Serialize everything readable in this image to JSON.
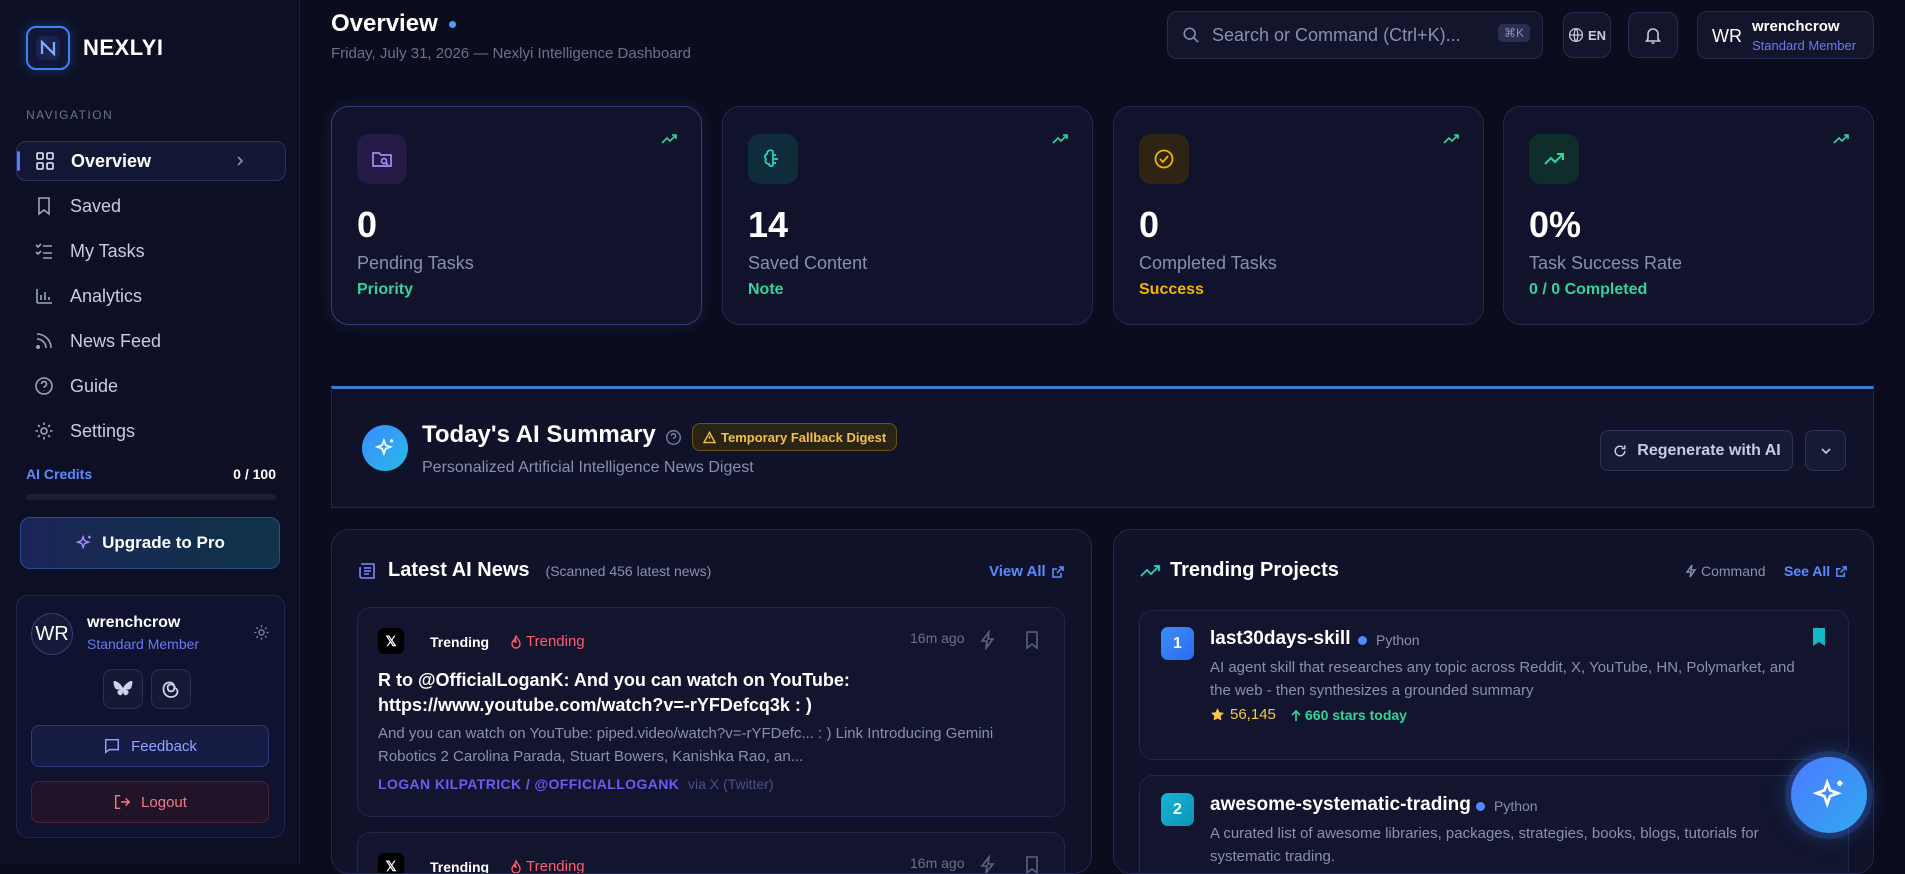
{
  "app": {
    "name": "NEXLYI"
  },
  "nav": {
    "label": "NAVIGATION",
    "items": [
      {
        "label": "Overview",
        "icon": "grid-icon",
        "active": true
      },
      {
        "label": "Saved",
        "icon": "bookmark-icon"
      },
      {
        "label": "My Tasks",
        "icon": "tasks-icon"
      },
      {
        "label": "Analytics",
        "icon": "bar-chart-icon"
      },
      {
        "label": "News Feed",
        "icon": "rss-icon"
      },
      {
        "label": "Guide",
        "icon": "help-circle-icon"
      },
      {
        "label": "Settings",
        "icon": "gear-icon"
      }
    ]
  },
  "credits": {
    "label": "AI Credits",
    "value": "0 / 100",
    "used_fraction": 0
  },
  "upgrade": {
    "label": "Upgrade to Pro"
  },
  "user": {
    "initials": "WR",
    "name": "wrenchcrow",
    "role": "Standard Member"
  },
  "sidebar_card": {
    "feedback": "Feedback",
    "logout": "Logout"
  },
  "header": {
    "title": "Overview",
    "subtitle": "Friday, July 31, 2026 — Nexlyi Intelligence Dashboard",
    "search_placeholder": "Search or Command (Ctrl+K)...",
    "search_kbd": "⌘K",
    "language": "EN"
  },
  "stats": [
    {
      "value": "0",
      "label": "Pending Tasks",
      "tag": "Priority",
      "color": "#34d399"
    },
    {
      "value": "14",
      "label": "Saved Content",
      "tag": "Note",
      "color": "#34d399"
    },
    {
      "value": "0",
      "label": "Completed Tasks",
      "tag": "Success",
      "color": "#f5b400"
    },
    {
      "value": "0%",
      "label": "Task Success Rate",
      "tag": "0 / 0 Completed",
      "color": "#34d399"
    }
  ],
  "summary": {
    "title": "Today's AI Summary",
    "badge": "Temporary Fallback Digest",
    "subtitle": "Personalized Artificial Intelligence News Digest",
    "regenerate": "Regenerate with AI"
  },
  "news": {
    "title": "Latest AI News",
    "scanned": "(Scanned 456 latest news)",
    "view_all": "View All",
    "items": [
      {
        "source": "Trending",
        "trend": "Trending",
        "time": "16m ago",
        "title": "R to @OfficialLoganK: And you can watch on YouTube: https://www.youtube.com/watch?v=-rYFDefcq3k : )",
        "desc": "And you can watch on YouTube: piped.video/watch?v=-rYFDefc... : ) Link Introducing Gemini Robotics 2 Carolina Parada, Stuart Bowers, Kanishka Rao, an...",
        "author": "LOGAN KILPATRICK / @OFFICIALLOGANK",
        "via": "via X (Twitter)"
      },
      {
        "source": "Trending",
        "trend": "Trending",
        "time": "16m ago"
      }
    ]
  },
  "trending": {
    "title": "Trending Projects",
    "command": "Command",
    "see_all": "See All",
    "items": [
      {
        "rank": "1",
        "name": "last30days-skill",
        "language": "Python",
        "desc": "AI agent skill that researches any topic across Reddit, X, YouTube, HN, Polymarket, and the web - then synthesizes a grounded summary",
        "stars": "56,145",
        "today": "660 stars today",
        "saved": true
      },
      {
        "rank": "2",
        "name": "awesome-systematic-trading",
        "language": "Python",
        "desc": "A curated list of awesome libraries, packages, strategies, books, blogs, tutorials for systematic trading."
      }
    ]
  }
}
